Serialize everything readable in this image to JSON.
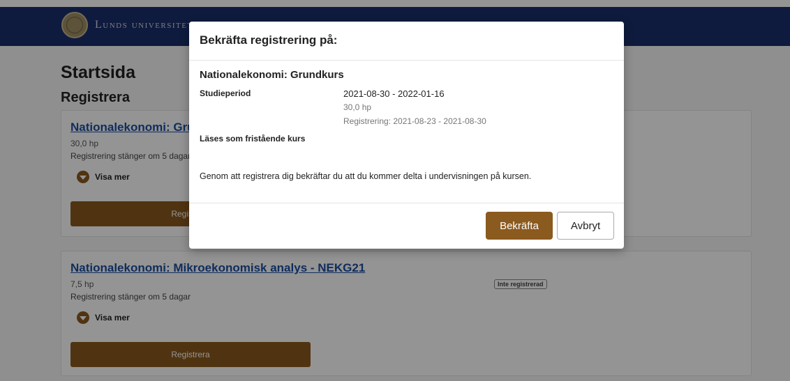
{
  "header": {
    "logo_text": "Lunds universitet"
  },
  "page": {
    "title": "Startsida",
    "subtitle": "Registrera"
  },
  "courses": [
    {
      "title": "Nationalekonomi: Grundkurs",
      "hp": "30,0 hp",
      "closing": "Registrering stänger om 5 dagar",
      "show_more": "Visa mer",
      "register_label": "Registrera"
    },
    {
      "title": "Nationalekonomi: Mikroekonomisk analys - NEKG21",
      "hp": "7,5 hp",
      "closing": "Registrering stänger om 5 dagar",
      "show_more": "Visa mer",
      "register_label": "Registrera",
      "status": "Inte registrerad"
    }
  ],
  "modal": {
    "title": "Bekräfta registrering på:",
    "course_name": "Nationalekonomi: Grundkurs",
    "period_label": "Studieperiod",
    "period_value": "2021-08-30 - 2022-01-16",
    "hp": "30,0 hp",
    "registration_period": "Registrering: 2021-08-23 - 2021-08-30",
    "standalone_label": "Läses som fristående kurs",
    "confirmation_text": "Genom att registrera dig bekräftar du att du kommer delta i undervisningen på kursen.",
    "confirm_label": "Bekräfta",
    "cancel_label": "Avbryt"
  },
  "colors": {
    "brand_navy": "#1b2f6b",
    "accent_brown": "#8b5a1e",
    "link_blue": "#1d4ea0"
  },
  "icons": {
    "show_more": "chevron-down-circle-icon",
    "logo": "university-seal-icon"
  }
}
